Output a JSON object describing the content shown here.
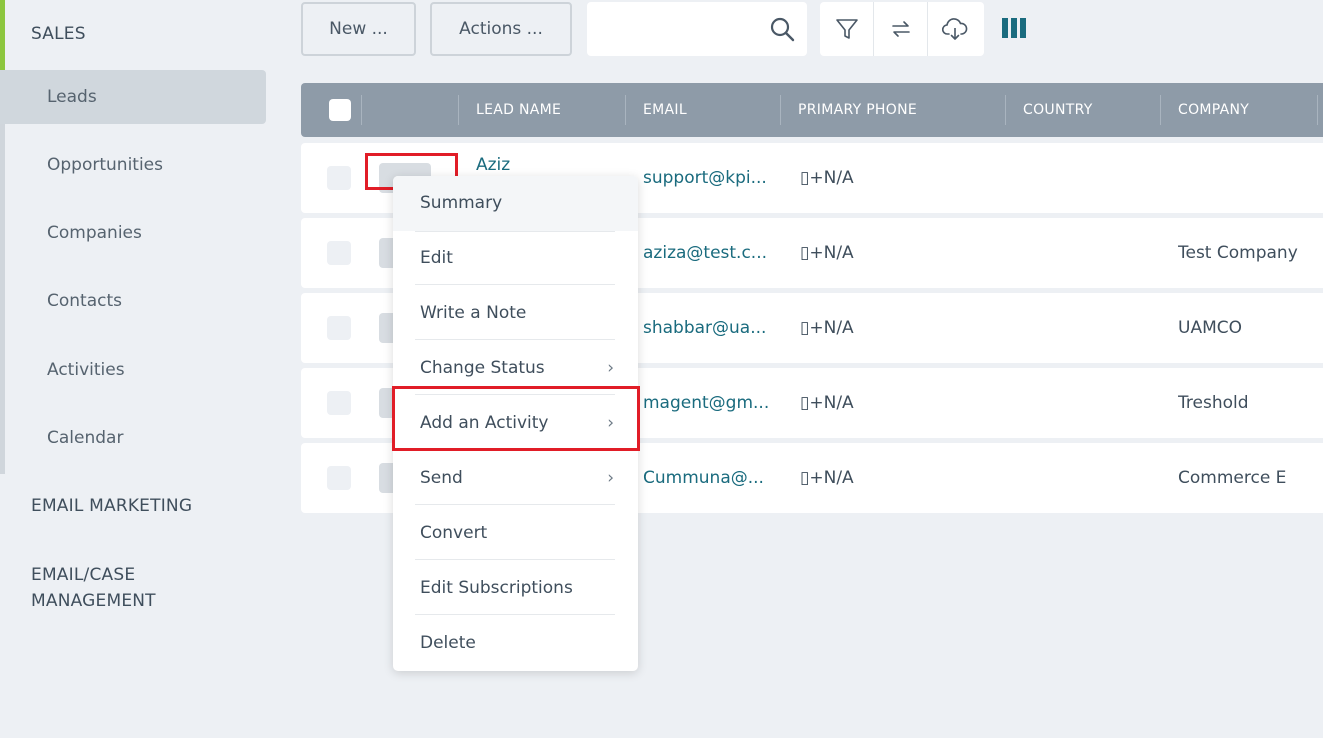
{
  "sidebar": {
    "sales": "SALES",
    "items": [
      {
        "label": "Leads"
      },
      {
        "label": "Opportunities"
      },
      {
        "label": "Companies"
      },
      {
        "label": "Contacts"
      },
      {
        "label": "Activities"
      },
      {
        "label": "Calendar"
      }
    ],
    "email_marketing": "EMAIL MARKETING",
    "email_case_1": "EMAIL/CASE",
    "email_case_2": "MANAGEMENT"
  },
  "toolbar": {
    "new_label": "New ...",
    "actions_label": "Actions ...",
    "search_value": ""
  },
  "table": {
    "headers": [
      "LEAD NAME",
      "EMAIL",
      "PRIMARY PHONE",
      "COUNTRY",
      "COMPANY"
    ],
    "rows": [
      {
        "name": "Aziz",
        "email": "support@kpi...",
        "phone": "▯+N/A",
        "country": "",
        "company": ""
      },
      {
        "name": "",
        "email": "aziza@test.c...",
        "phone": "▯+N/A",
        "country": "",
        "company": "Test Company"
      },
      {
        "name": "",
        "email": "shabbar@ua...",
        "phone": "▯+N/A",
        "country": "",
        "company": "UAMCO"
      },
      {
        "name": "",
        "email": "magent@gm...",
        "phone": "▯+N/A",
        "country": "",
        "company": "Treshold"
      },
      {
        "name": "",
        "email": "Cummuna@...",
        "phone": "▯+N/A",
        "country": "",
        "company": "Commerce E"
      }
    ]
  },
  "menu": {
    "items": [
      {
        "label": "Summary"
      },
      {
        "label": "Edit"
      },
      {
        "label": "Write a Note"
      },
      {
        "label": "Change Status",
        "chevron": "›"
      },
      {
        "label": "Add an Activity",
        "chevron": "›"
      },
      {
        "label": "Send",
        "chevron": "›"
      },
      {
        "label": "Convert"
      },
      {
        "label": "Edit Subscriptions"
      },
      {
        "label": "Delete"
      }
    ]
  },
  "colors": {
    "accent": "#8cc63e",
    "link": "#1a6b7e",
    "header": "#8e9ba8",
    "highlight": "#e11d27"
  }
}
